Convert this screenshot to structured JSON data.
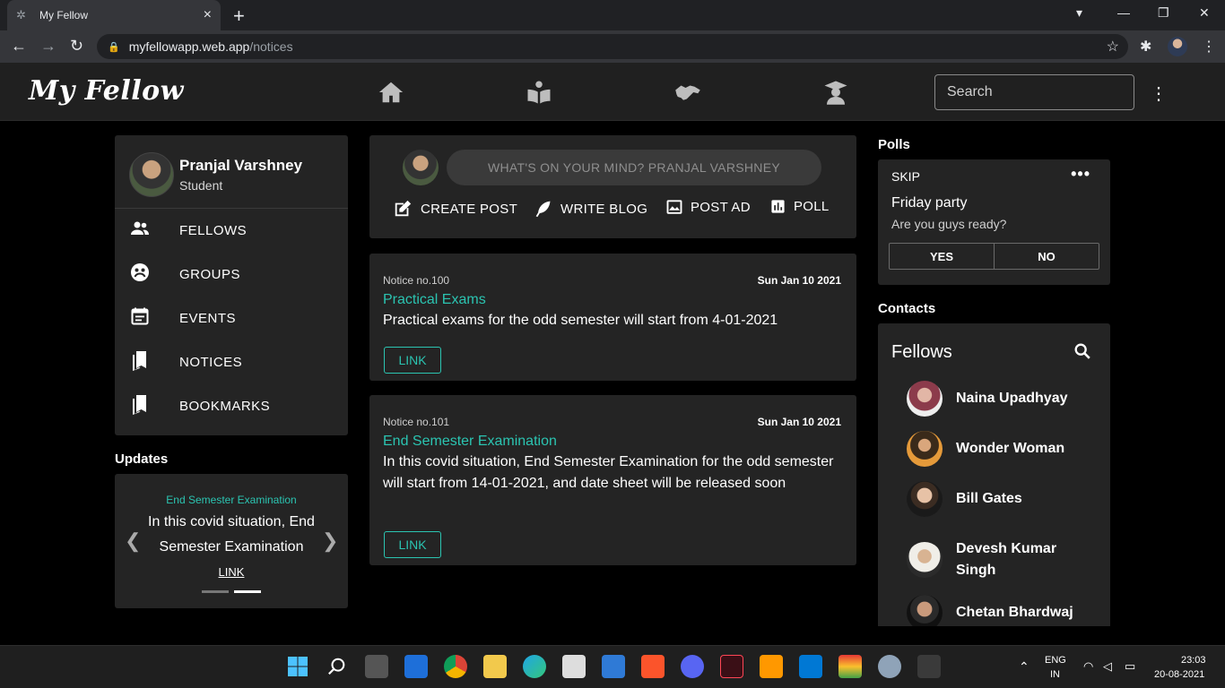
{
  "browser": {
    "tab_title": "My Fellow",
    "url_host": "myfellowapp.web.app",
    "url_path": "/notices"
  },
  "header": {
    "logo": "My Fellow",
    "search_placeholder": "Search",
    "nav_icons": [
      "home-icon",
      "book-icon",
      "handshake-icon",
      "graduate-icon"
    ]
  },
  "profile": {
    "name": "Pranjal Varshney",
    "role": "Student",
    "menu": [
      {
        "label": "FELLOWS",
        "icon": "people-icon"
      },
      {
        "label": "GROUPS",
        "icon": "groups-icon"
      },
      {
        "label": "EVENTS",
        "icon": "events-icon"
      },
      {
        "label": "NOTICES",
        "icon": "notices-icon"
      },
      {
        "label": "BOOKMARKS",
        "icon": "bookmarks-icon"
      }
    ]
  },
  "updates": {
    "section_title": "Updates",
    "title": "End Semester Examination",
    "text": "In this covid situation, End Semester Examination",
    "link": "LINK"
  },
  "composer": {
    "placeholder": "WHAT'S ON YOUR MIND? PRANJAL VARSHNEY",
    "actions": {
      "create_post": "CREATE POST",
      "write_blog": "WRITE BLOG",
      "post_ad": "POST AD",
      "poll": "POLL"
    }
  },
  "notices": [
    {
      "number": "Notice no.100",
      "date": "Sun Jan 10 2021",
      "title": "Practical Exams",
      "body": "Practical exams for the odd semester will start from 4-01-2021",
      "link": "LINK"
    },
    {
      "number": "Notice no.101",
      "date": "Sun Jan 10 2021",
      "title": "End Semester Examination",
      "body": "In this covid situation, End Semester Examination for the odd semester will start from 14-01-2021, and date sheet will be released soon",
      "link": "LINK"
    }
  ],
  "polls": {
    "section_title": "Polls",
    "skip": "SKIP",
    "more": "•••",
    "question": "Friday party",
    "description": "Are you guys ready?",
    "yes": "YES",
    "no": "NO"
  },
  "contacts": {
    "section_title": "Contacts",
    "title": "Fellows",
    "people": [
      {
        "name": "Naina Upadhyay"
      },
      {
        "name": "Wonder Woman"
      },
      {
        "name": "Bill Gates"
      },
      {
        "name": "Devesh Kumar Singh"
      },
      {
        "name": "Chetan Bhardwaj"
      }
    ]
  },
  "taskbar": {
    "lang_top": "ENG",
    "lang_bottom": "IN",
    "time": "23:03",
    "date": "20-08-2021"
  },
  "colors": {
    "accent": "#2bc4b1",
    "card": "#242424",
    "background": "#000000",
    "header": "#202020"
  }
}
